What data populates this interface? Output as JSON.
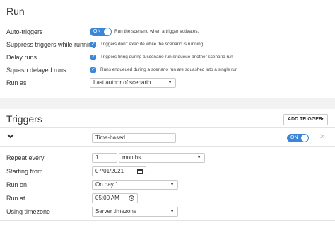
{
  "run": {
    "title": "Run",
    "auto_triggers": {
      "label": "Auto-triggers",
      "toggle": "ON",
      "help": "Run the scenario when a trigger activates."
    },
    "suppress": {
      "label": "Suppress triggers while running",
      "help": "Triggers don't execute while the scenario is running"
    },
    "delay": {
      "label": "Delay runs",
      "help": "Triggers firing during a scenario run enqueue another scenario run"
    },
    "squash": {
      "label": "Squash delayed runs",
      "help": "Runs enqueued during a scenario run are squashed into a single run"
    },
    "run_as": {
      "label": "Run as",
      "value": "Last author of scenario"
    }
  },
  "triggers": {
    "title": "Triggers",
    "add_button": "ADD TRIGGER",
    "trigger": {
      "name": "Time-based",
      "toggle": "ON",
      "repeat_every": {
        "label": "Repeat every",
        "count": "1",
        "unit": "months"
      },
      "starting_from": {
        "label": "Starting from",
        "value": "07/01/2021"
      },
      "run_on": {
        "label": "Run on",
        "value": "On day 1"
      },
      "run_at": {
        "label": "Run at",
        "value": "05:00 AM"
      },
      "timezone": {
        "label": "Using timezone",
        "value": "Server timezone"
      }
    }
  },
  "colors": {
    "accent": "#3b86d6",
    "band": "#f2f2f2"
  },
  "icons": {
    "check": "check-icon",
    "caret": "caret-down-icon",
    "chevron": "chevron-down-icon",
    "close": "close-icon",
    "calendar": "calendar-icon",
    "clock": "clock-icon"
  }
}
